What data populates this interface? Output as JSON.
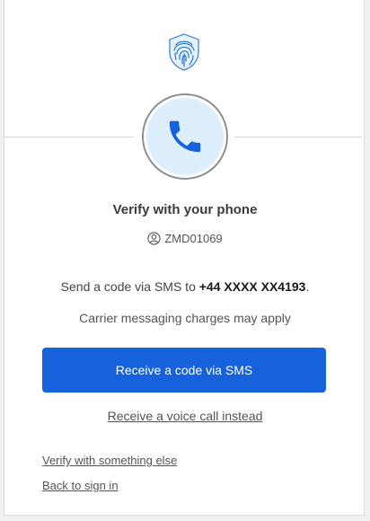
{
  "header": {
    "logo_icon": "fingerprint-shield-icon",
    "phone_icon": "phone-icon",
    "accent_color": "#1662dd"
  },
  "main": {
    "title": "Verify with your phone",
    "username": "ZMD01069",
    "user_icon": "user-icon",
    "send_prefix": "Send a code via SMS to ",
    "phone_number": "+44 XXXX XX4193",
    "send_suffix": ".",
    "carrier_note": "Carrier messaging charges may apply",
    "primary_button": "Receive a code via SMS",
    "voice_link": "Receive a voice call instead"
  },
  "footer": {
    "verify_else": "Verify with something else",
    "back_to_sign_in": "Back to sign in"
  }
}
